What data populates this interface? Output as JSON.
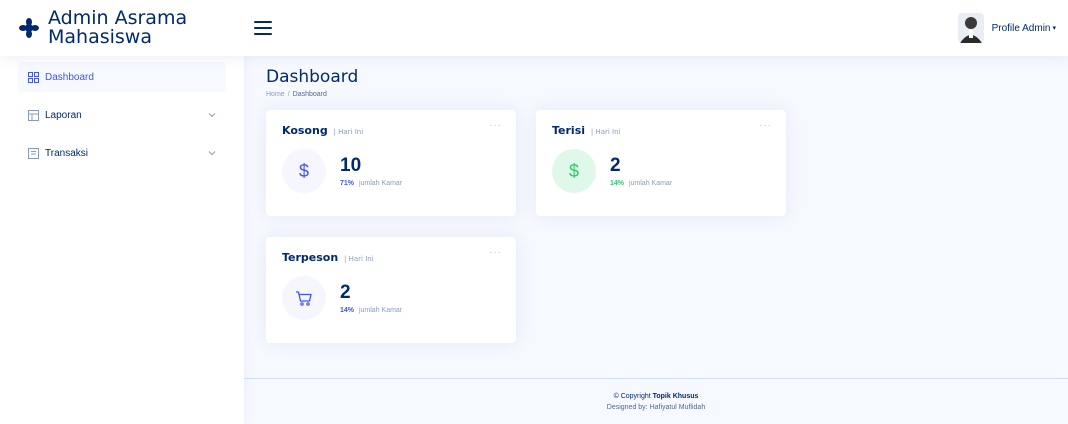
{
  "header": {
    "app_title_line1": "Admin Asrama",
    "app_title_line2": "Mahasiswa",
    "profile_label": "Profile Admin",
    "profile_caret": "▾"
  },
  "sidebar": {
    "items": [
      {
        "label": "Dashboard",
        "active": true
      },
      {
        "label": "Laporan",
        "active": false
      },
      {
        "label": "Transaksi",
        "active": false
      }
    ]
  },
  "main": {
    "page_title": "Dashboard",
    "breadcrumb": [
      "Home",
      "Dashboard"
    ],
    "breadcrumb_sep": "/",
    "cards": [
      {
        "title": "Kosong",
        "subtitle": "| Hari Ini",
        "icon": "dollar-icon",
        "icon_glyph": "$",
        "value": "10",
        "percent": "71%",
        "caption": "jumlah Kamar"
      },
      {
        "title": "Terisi",
        "subtitle": "| Hari Ini",
        "icon": "dollar-icon",
        "icon_glyph": "$",
        "value": "2",
        "percent": "14%",
        "caption": "jumlah Kamar"
      },
      {
        "title": "Terpeson",
        "subtitle": "| Hari Ini",
        "icon": "cart-icon",
        "icon_glyph": "",
        "value": "2",
        "percent": "14%",
        "caption": "jumlah Kamar"
      }
    ],
    "card_menu": "···"
  },
  "footer": {
    "copyright_prefix": "© Copyright",
    "copyright_name": "Topik Khusus",
    "designed_by": "Designed by: Hafiyatul Muflidah"
  },
  "colors": {
    "primary": "#4154f1",
    "navy": "#012970",
    "green": "#2eca6a",
    "background": "#f6f9ff"
  }
}
